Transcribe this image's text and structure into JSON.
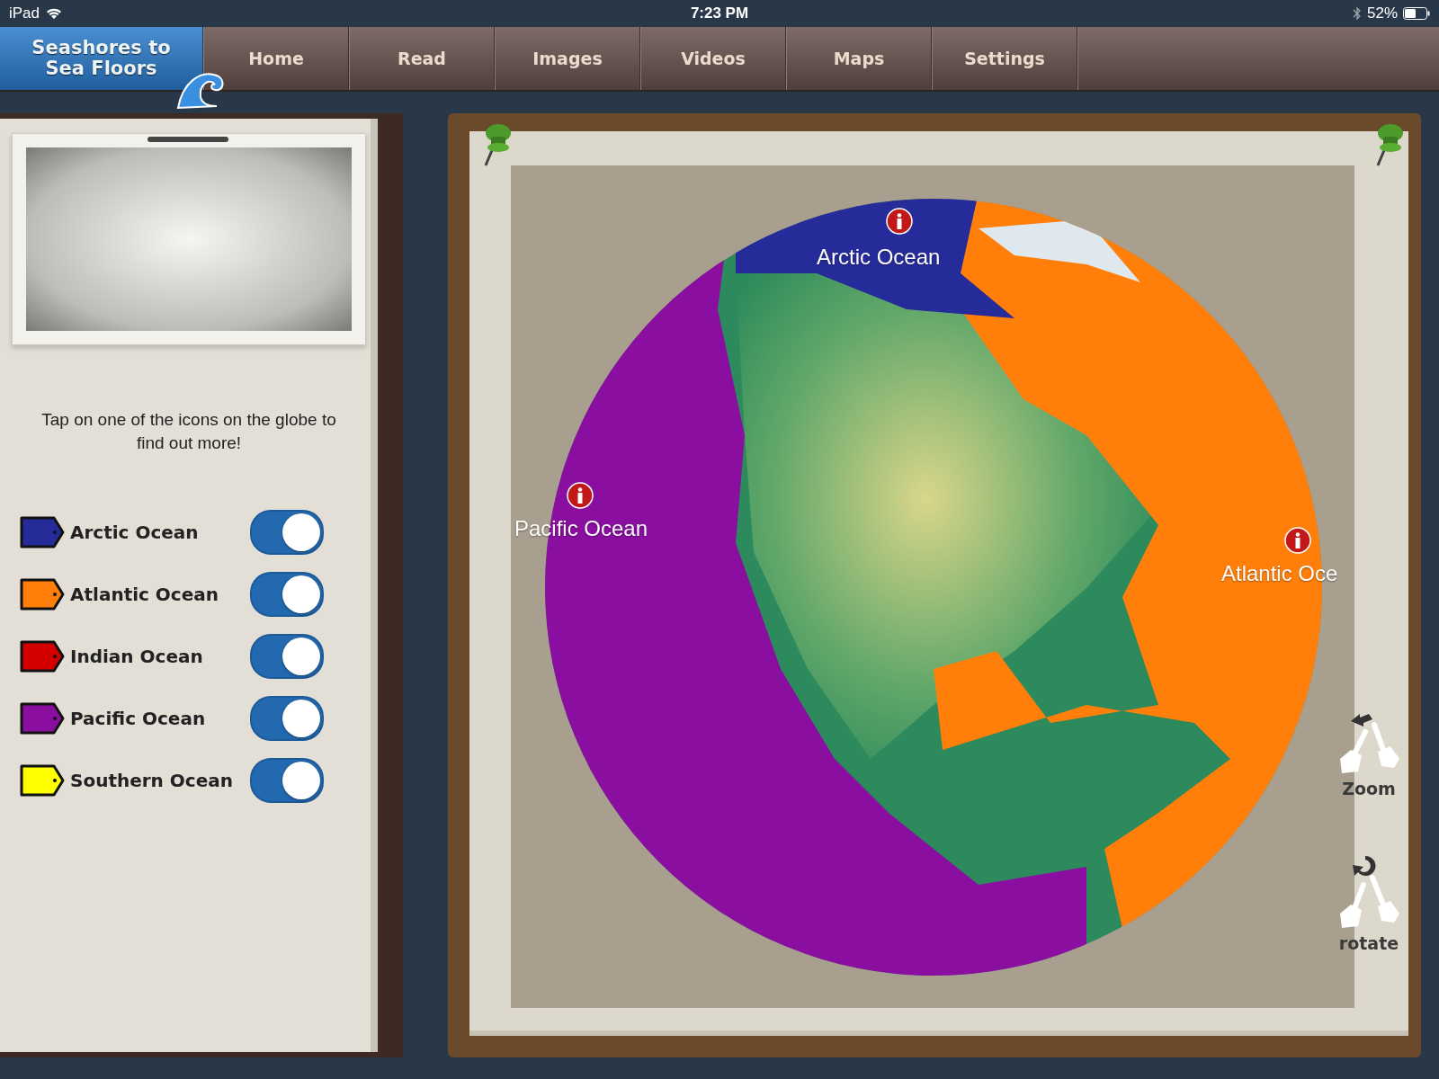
{
  "status_bar": {
    "device": "iPad",
    "time": "7:23 PM",
    "battery": "52%"
  },
  "app_title": [
    "Seashores to",
    "Sea Floors"
  ],
  "nav": [
    {
      "label": "Home"
    },
    {
      "label": "Read"
    },
    {
      "label": "Images"
    },
    {
      "label": "Videos"
    },
    {
      "label": "Maps"
    },
    {
      "label": "Settings"
    }
  ],
  "panel": {
    "instruction": "Tap on one of the icons on the globe to find out more!",
    "layers": [
      {
        "name": "Arctic Ocean",
        "color": "#262b9a",
        "on": true
      },
      {
        "name": "Atlantic Ocean",
        "color": "#ff7f0a",
        "on": true
      },
      {
        "name": "Indian Ocean",
        "color": "#d40000",
        "on": true
      },
      {
        "name": "Pacific Ocean",
        "color": "#8a0ea0",
        "on": true
      },
      {
        "name": "Southern Ocean",
        "color": "#ffff00",
        "on": true
      }
    ]
  },
  "map": {
    "labels": [
      {
        "text": "Arctic Ocean"
      },
      {
        "text": "Pacific Ocean"
      },
      {
        "text": "Atlantic Oce"
      }
    ],
    "gestures": [
      {
        "kind": "zoom",
        "label": "Zoom"
      },
      {
        "kind": "rotate",
        "label": "rotate"
      }
    ]
  }
}
